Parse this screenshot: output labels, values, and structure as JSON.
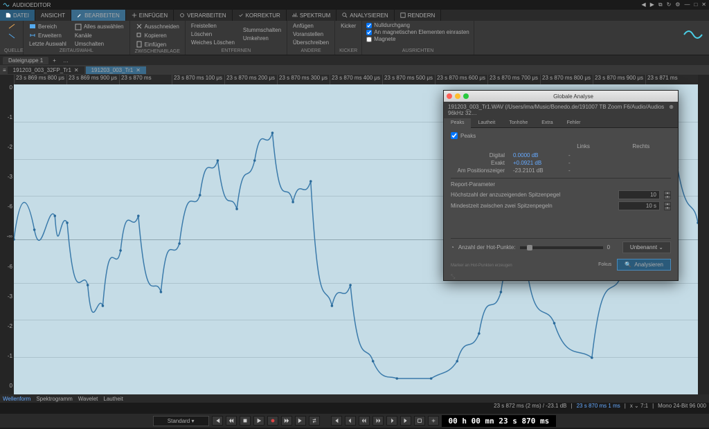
{
  "app": {
    "title": "AUDIOEDITOR"
  },
  "menus": {
    "file": "DATEI",
    "tabs": [
      "ANSICHT",
      "BEARBEITEN",
      "EINFÜGEN",
      "VERARBEITEN",
      "KORREKTUR",
      "SPEKTRUM",
      "ANALYSIEREN",
      "RENDERN"
    ],
    "active_index": 1
  },
  "ribbon": {
    "g0": {
      "items": [
        "Zeit",
        "Pegel"
      ],
      "label": "QUELLE"
    },
    "g1": {
      "items": [
        "Bereich",
        "Erweitern",
        "Letzte Auswahl"
      ],
      "sub": [
        "Alles auswählen",
        "Kanäle",
        "Umschalten"
      ],
      "label": "ZEITAUSWAHL"
    },
    "g2": {
      "items": [
        "Ausschneiden",
        "Kopieren",
        "Einfügen"
      ],
      "label": "ZWISCHENABLAGE"
    },
    "g3": {
      "items": [
        "Freistellen",
        "Löschen",
        "Weiches Löschen"
      ],
      "sub": [
        "Stummschalten",
        "Umkehren"
      ],
      "label": "ENTFERNEN"
    },
    "g4": {
      "items": [
        "Anfügen",
        "Voranstellen",
        "Überschreiben"
      ],
      "label": "ANDERE"
    },
    "g5": {
      "items": [
        "Kicker"
      ],
      "label": "KICKER"
    },
    "checks": {
      "c1": "Nulldurchgang",
      "c2": "An magnetischen Elementen einrasten",
      "c3": "Magnete"
    },
    "checks_label": "AUSRICHTEN"
  },
  "tabgroup": {
    "name": "Dateigruppe 1"
  },
  "files": {
    "f1": "191203_003_32FP_Tr1",
    "f2": "191203_003_Tr1"
  },
  "timeline": {
    "ticks": [
      "23 s 869 ms 800 μs",
      "23 s 869 ms 900 μs",
      "23 s 870 ms",
      "23 s 870 ms 100 μs",
      "23 s 870 ms 200 μs",
      "23 s 870 ms 300 μs",
      "23 s 870 ms 400 μs",
      "23 s 870 ms 500 μs",
      "23 s 870 ms 600 μs",
      "23 s 870 ms 700 μs",
      "23 s 870 ms 800 μs",
      "23 s 870 ms 900 μs",
      "23 s 871 ms"
    ]
  },
  "yaxis": [
    "0",
    "-1",
    "-2",
    "-3",
    "-6",
    "-∞",
    "-6",
    "-3",
    "-2",
    "-1",
    "0"
  ],
  "viewtabs": {
    "wf": "Wellenform",
    "sp": "Spektrogramm",
    "wl": "Wavelet",
    "ld": "Lautheit"
  },
  "status": {
    "sel": "23 s 872 ms (2 ms) / -23.1 dB",
    "pos": "23 s 870 ms   1 ms",
    "zoom": "x ⌄ 7:1",
    "device": "Mono 24-Bit 96 000"
  },
  "transport": {
    "preset": "Standard",
    "time": "00 h 00 mn 23 s 870 ms"
  },
  "dialog": {
    "title": "Globale Analyse",
    "path": "191203_003_Tr1.WAV (/Users/ima/Music/Bonedo.de/191007 TB Zoom F6/Audio/Audios 96kHz 32…",
    "tabs": [
      "Peaks",
      "Lautheit",
      "Tonhöhe",
      "Extra",
      "Fehler"
    ],
    "peaks_check": "Peaks",
    "cols": {
      "l": "Links",
      "r": "Rechts"
    },
    "rows": [
      {
        "lbl": "Digital",
        "v": "0.0000 dB",
        "link": true
      },
      {
        "lbl": "Exakt",
        "v": "+0.0921 dB",
        "link": true
      },
      {
        "lbl": "Am Positionszeiger",
        "v": "-23.2101 dB",
        "link": false
      }
    ],
    "report_hdr": "Report-Parameter",
    "p1": {
      "lbl": "Höchstzahl der anzuzeigenden Spitzenpegel",
      "val": "10"
    },
    "p2": {
      "lbl": "Mindestzeit zwischen zwei Spitzenpegeln",
      "val": "10 s"
    },
    "hot": {
      "lbl": "Anzahl der Hot-Punkte:",
      "val": "0"
    },
    "hint": "Marker an Hot-Punkten erzeugen",
    "foc": "Fokus",
    "btn_unb": "Unbenannt ⌄",
    "btn_an": "Analysieren"
  }
}
